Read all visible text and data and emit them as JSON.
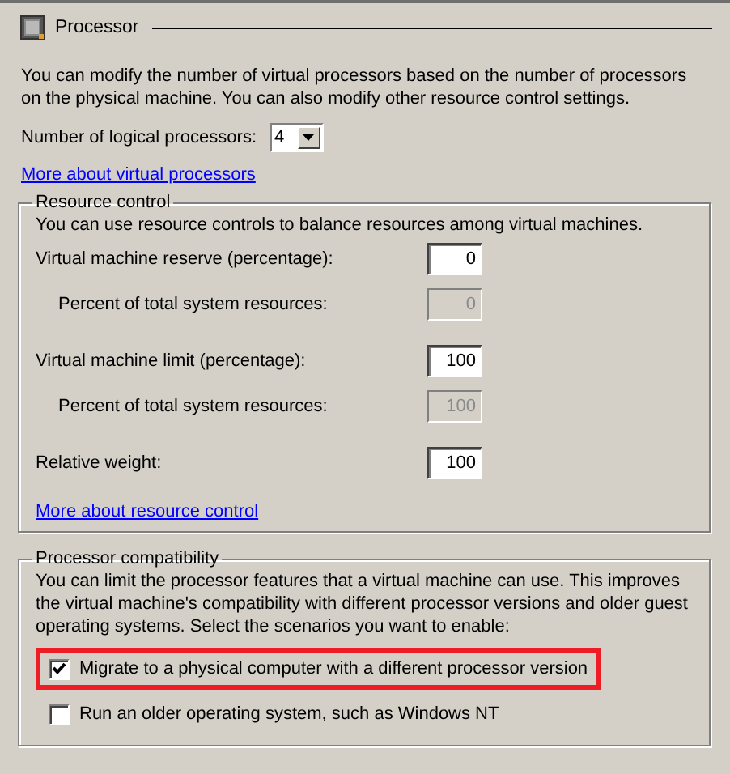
{
  "section": {
    "title": "Processor"
  },
  "description": "You can modify the number of virtual processors based on the number of processors on the physical machine. You can also modify other resource control settings.",
  "processors": {
    "label": "Number of logical processors:",
    "value": "4"
  },
  "processors_link": "More about virtual processors",
  "resource_control": {
    "title": "Resource control",
    "description": "You can use resource controls to balance resources among virtual machines.",
    "rows": [
      {
        "label": "Virtual machine reserve (percentage):",
        "value": "0",
        "disabled": false,
        "children": [
          {
            "label": "Percent of total system resources:",
            "value": "0",
            "disabled": true
          }
        ]
      },
      {
        "label": "Virtual machine limit (percentage):",
        "value": "100",
        "disabled": false,
        "children": [
          {
            "label": "Percent of total system resources:",
            "value": "100",
            "disabled": true
          }
        ]
      },
      {
        "label": "Relative weight:",
        "value": "100",
        "disabled": false
      }
    ],
    "link": "More about resource control"
  },
  "compatibility": {
    "title": "Processor compatibility",
    "description": "You can limit the processor features that a virtual machine can use. This improves the virtual machine's compatibility with different processor versions and older guest operating systems. Select the scenarios you want to enable:",
    "options": [
      {
        "label": "Migrate to a physical computer with a different processor version",
        "checked": true,
        "highlighted": true
      },
      {
        "label": "Run an older operating system, such as Windows NT",
        "checked": false,
        "highlighted": false
      }
    ]
  }
}
